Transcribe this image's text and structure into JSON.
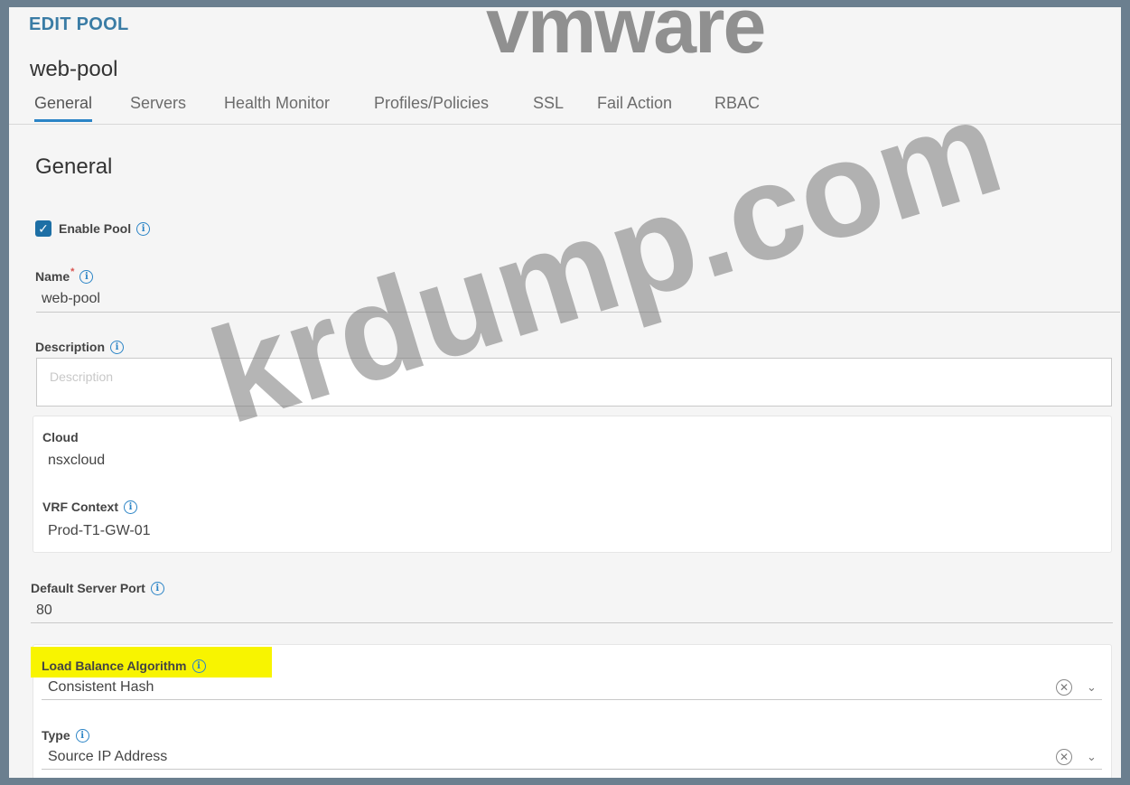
{
  "header": {
    "title": "EDIT POOL",
    "pool_name": "web-pool"
  },
  "tabs": [
    {
      "label": "General",
      "active": true
    },
    {
      "label": "Servers"
    },
    {
      "label": "Health Monitor"
    },
    {
      "label": "Profiles/Policies"
    },
    {
      "label": "SSL"
    },
    {
      "label": "Fail Action"
    },
    {
      "label": "RBAC"
    }
  ],
  "general": {
    "section_title": "General",
    "enable_pool": {
      "label": "Enable Pool",
      "checked": true
    },
    "name": {
      "label": "Name",
      "required_mark": "*",
      "value": "web-pool"
    },
    "description": {
      "label": "Description",
      "placeholder": "Description"
    },
    "cloud": {
      "label": "Cloud",
      "value": "nsxcloud"
    },
    "vrf_context": {
      "label": "VRF Context",
      "value": "Prod-T1-GW-01"
    },
    "default_server_port": {
      "label": "Default Server Port",
      "value": "80"
    },
    "load_balance_algorithm": {
      "label": "Load Balance Algorithm",
      "value": "Consistent Hash"
    },
    "type": {
      "label": "Type",
      "value": "Source IP Address"
    }
  },
  "watermarks": {
    "vmware": "vmware",
    "site": "krdump.com"
  },
  "colors": {
    "accent": "#2b84c6",
    "checkbox": "#1d6fa5",
    "highlight": "#f8f400"
  },
  "icons": {
    "info": "info-icon",
    "clear": "clear-circle-icon",
    "dropdown": "chevron-down-icon",
    "check": "checkmark-icon"
  }
}
